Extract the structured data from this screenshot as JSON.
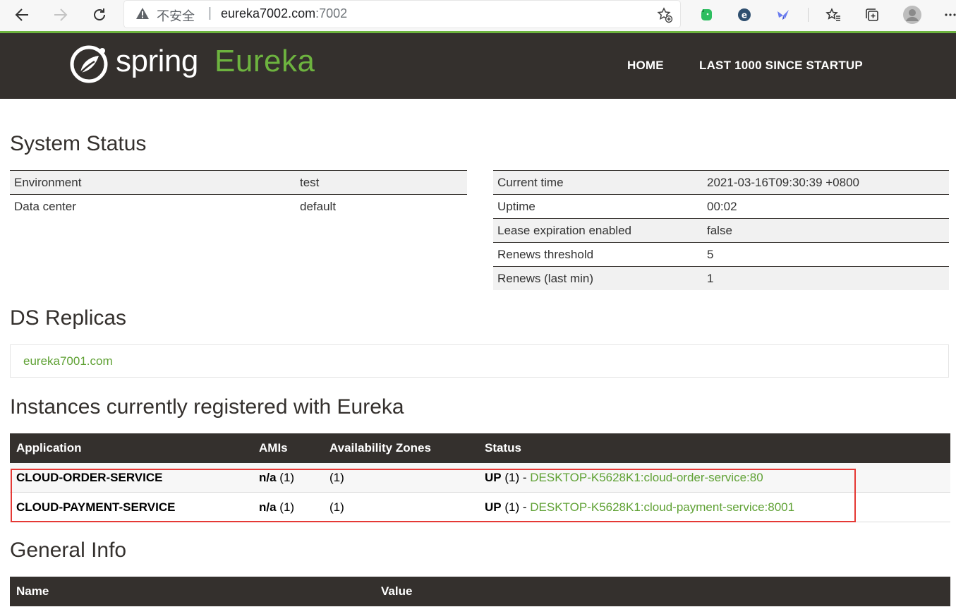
{
  "browser": {
    "insecure_label": "不安全",
    "separator": "|",
    "url_host": "eureka7002.com",
    "url_port": ":7002",
    "icons": [
      "back-arrow-icon",
      "forward-arrow-icon",
      "reload-icon",
      "warning-icon",
      "add-favorite-icon",
      "evernote-extension-icon",
      "extension-e-icon",
      "extension-bird-icon",
      "favorites-icon",
      "collections-icon",
      "profile-avatar-icon",
      "more-menu-icon"
    ]
  },
  "header": {
    "logo_spring": "spring",
    "logo_eureka": "Eureka",
    "nav": {
      "home": "HOME",
      "last1000": "LAST 1000 SINCE STARTUP"
    },
    "colors": {
      "bar": "#34302d",
      "accent": "#6db33f"
    }
  },
  "system_status": {
    "title": "System Status",
    "left": [
      {
        "key": "Environment",
        "value": "test"
      },
      {
        "key": "Data center",
        "value": "default"
      }
    ],
    "right": [
      {
        "key": "Current time",
        "value": "2021-03-16T09:30:39 +0800"
      },
      {
        "key": "Uptime",
        "value": "00:02"
      },
      {
        "key": "Lease expiration enabled",
        "value": "false"
      },
      {
        "key": "Renews threshold",
        "value": "5"
      },
      {
        "key": "Renews (last min)",
        "value": "1"
      }
    ]
  },
  "ds_replicas": {
    "title": "DS Replicas",
    "items": [
      "eureka7001.com"
    ]
  },
  "instances": {
    "title": "Instances currently registered with Eureka",
    "headers": [
      "Application",
      "AMIs",
      "Availability Zones",
      "Status"
    ],
    "rows": [
      {
        "app": "CLOUD-ORDER-SERVICE",
        "ami": "n/a",
        "ami_count": "(1)",
        "zones": "(1)",
        "status": "UP",
        "status_count": "(1) -",
        "instance": "DESKTOP-K5628K1:cloud-order-service:80"
      },
      {
        "app": "CLOUD-PAYMENT-SERVICE",
        "ami": "n/a",
        "ami_count": "(1)",
        "zones": "(1)",
        "status": "UP",
        "status_count": "(1) -",
        "instance": "DESKTOP-K5628K1:cloud-payment-service:8001"
      }
    ]
  },
  "general_info": {
    "title": "General Info",
    "headers": [
      "Name",
      "Value"
    ]
  }
}
